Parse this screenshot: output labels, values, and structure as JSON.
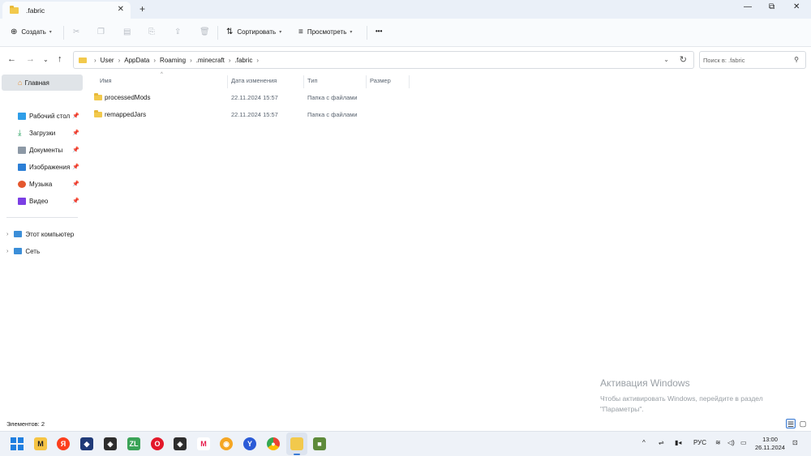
{
  "window": {
    "tab_title": ".fabric",
    "tab_close": "✕",
    "new_tab": "+",
    "minimize": "—",
    "maximize": "⧉",
    "close": "✕"
  },
  "toolbar": {
    "create_label": "Создать",
    "sort_label": "Сортировать",
    "view_label": "Просмотреть",
    "more_label": "•••"
  },
  "address": {
    "breadcrumbs": [
      "User",
      "AppData",
      "Roaming",
      ".minecraft",
      ".fabric"
    ],
    "search_placeholder": "Поиск в: .fabric"
  },
  "sidebar": {
    "home_label": "Главная",
    "quick_access": [
      {
        "label": "Рабочий стол",
        "icon": "desktop-icon",
        "color": "#2f9ee8"
      },
      {
        "label": "Загрузки",
        "icon": "download-icon",
        "color": "#1e9e5a"
      },
      {
        "label": "Документы",
        "icon": "documents-icon",
        "color": "#8d99a6"
      },
      {
        "label": "Изображения",
        "icon": "pictures-icon",
        "color": "#2c7fd6"
      },
      {
        "label": "Музыка",
        "icon": "music-icon",
        "color": "#e4572e"
      },
      {
        "label": "Видео",
        "icon": "videos-icon",
        "color": "#7b3fe4"
      }
    ],
    "tree": [
      {
        "label": "Этот компьютер",
        "icon": "this-pc-icon"
      },
      {
        "label": "Сеть",
        "icon": "network-icon"
      }
    ]
  },
  "columns": {
    "name": "Имя",
    "date": "Дата изменения",
    "type": "Тип",
    "size": "Размер"
  },
  "files": [
    {
      "name": "processedMods",
      "date": "22.11.2024 15:57",
      "type": "Папка с файлами"
    },
    {
      "name": "remappedJars",
      "date": "22.11.2024 15:57",
      "type": "Папка с файлами"
    }
  ],
  "watermark": {
    "title": "Активация Windows",
    "line1": "Чтобы активировать Windows, перейдите в раздел",
    "line2": "\"Параметры\"."
  },
  "statusbar": {
    "count": "Элементов: 2"
  },
  "taskbar": {
    "lang": "РУС",
    "time": "13:00",
    "date": "26.11.2024"
  },
  "colors": {
    "accent": "#3a7bd5",
    "folder": "#f2c94c"
  }
}
